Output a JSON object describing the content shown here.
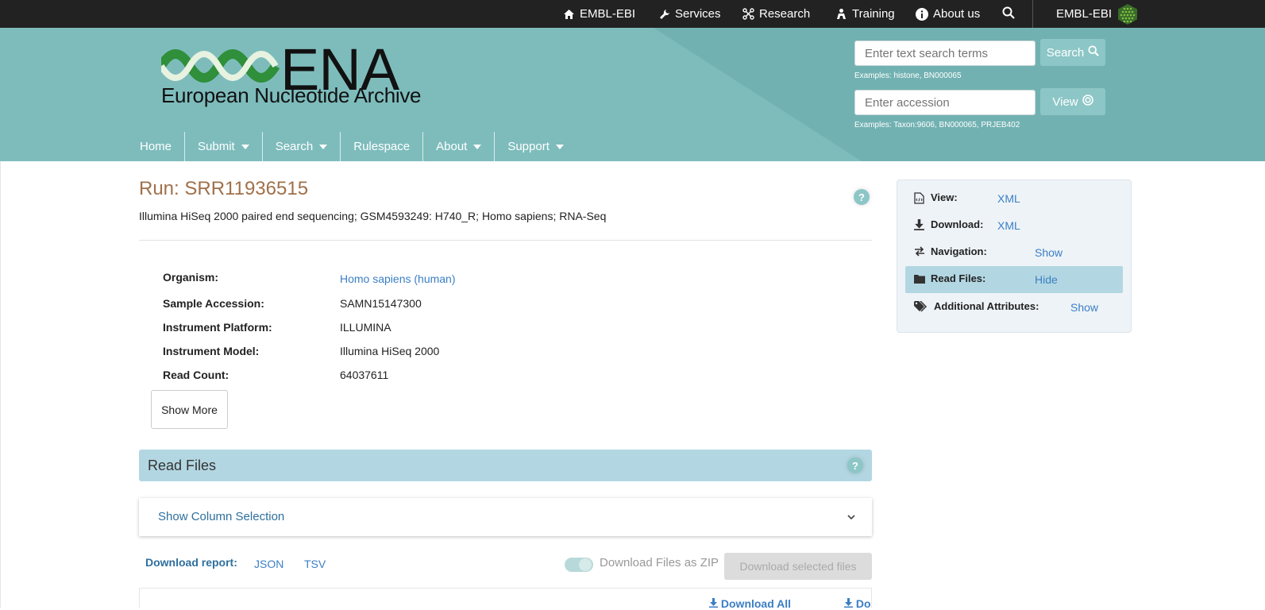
{
  "topbar": {
    "items": [
      {
        "label": "EMBL-EBI",
        "icon": "home-icon"
      },
      {
        "label": "Services",
        "icon": "wrench-icon"
      },
      {
        "label": "Research",
        "icon": "research-icon"
      },
      {
        "label": "Training",
        "icon": "training-icon"
      },
      {
        "label": "About us",
        "icon": "info-icon"
      }
    ],
    "search_icon": "search-icon",
    "brand": "EMBL-EBI"
  },
  "masthead": {
    "logo_title": "ENA",
    "logo_subtitle": "European Nucleotide Archive",
    "search_placeholder": "Enter text search terms",
    "search_button": "Search",
    "search_examples": "Examples: histone, BN000065",
    "accession_placeholder": "Enter accession",
    "view_button": "View",
    "accession_examples": "Examples: Taxon:9606, BN000065, PRJEB402",
    "colors": {
      "masthead": "#7ebcbc",
      "button": "#8dc6c6"
    }
  },
  "nav": {
    "home": "Home",
    "submit": "Submit",
    "search": "Search",
    "rulespace": "Rulespace",
    "about": "About",
    "support": "Support"
  },
  "run": {
    "title": "Run: SRR11936515",
    "description": "Illumina HiSeq 2000 paired end sequencing; GSM4593249: H740_R; Homo sapiens; RNA-Seq",
    "help": "?",
    "fields": [
      {
        "label": "Organism:",
        "value": "Homo sapiens (human)"
      },
      {
        "label": "Sample Accession:",
        "value": "SAMN15147300"
      },
      {
        "label": "Instrument Platform:",
        "value": "ILLUMINA"
      },
      {
        "label": "Instrument Model:",
        "value": "Illumina HiSeq 2000"
      },
      {
        "label": "Read Count:",
        "value": "64037611"
      }
    ],
    "show_more": "Show More"
  },
  "read_files": {
    "title": "Read Files",
    "help": "?",
    "column_selection": "Show Column Selection",
    "download_report_label": "Download report:",
    "json": "JSON",
    "tsv": "TSV",
    "zip_toggle_label": "Download Files as ZIP",
    "zip_toggle_on": true,
    "download_selected": "Download selected files",
    "download_all": "Download All",
    "download_partial": "Do"
  },
  "side": {
    "rows": [
      {
        "label": "View:",
        "value": "XML",
        "icon": "xml-file-icon"
      },
      {
        "label": "Download:",
        "value": "XML",
        "icon": "download-icon"
      },
      {
        "label": "Navigation:",
        "value": "Show",
        "icon": "exchange-icon"
      },
      {
        "label": "Read Files:",
        "value": "Hide",
        "icon": "folder-icon"
      },
      {
        "label": "Additional Attributes:",
        "value": "Show",
        "icon": "tags-icon"
      }
    ]
  }
}
